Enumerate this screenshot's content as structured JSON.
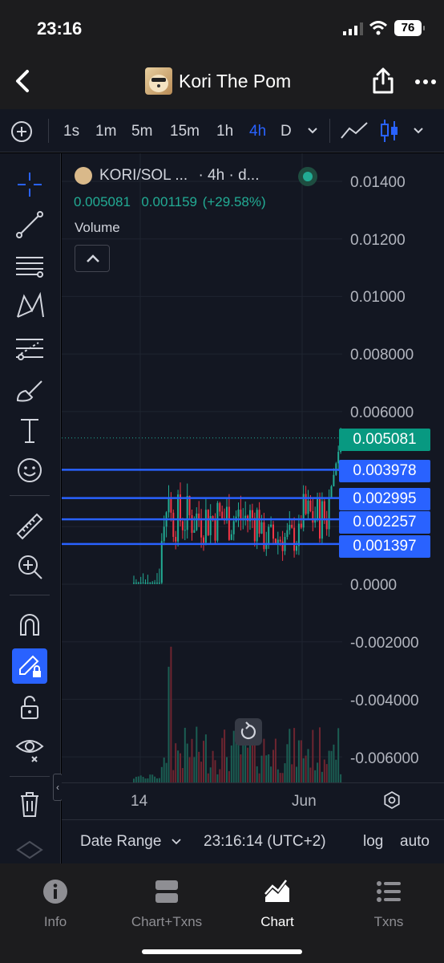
{
  "status_bar": {
    "time": "23:16",
    "battery": "76"
  },
  "header": {
    "title": "Kori The Pom"
  },
  "timeframes": [
    "1s",
    "1m",
    "5m",
    "15m",
    "1h",
    "4h",
    "D"
  ],
  "active_timeframe": "4h",
  "legend": {
    "symbol": "KORI/SOL ...",
    "interval": "· 4h · d...",
    "values": "0.005081  0.001159 (+29.58%)",
    "volume_label": "Volume"
  },
  "price_axis": [
    "0.01400",
    "0.01200",
    "0.01000",
    "0.008000",
    "0.006000",
    "0.0000",
    "-0.002000",
    "-0.004000",
    "-0.006000"
  ],
  "level_tags": {
    "current": "0.005081",
    "l1": "0.003978",
    "l2": "0.002995",
    "l3": "0.002257",
    "l4": "0.001397"
  },
  "x_axis": {
    "label_1": "14",
    "label_2": "Jun"
  },
  "chart_bottom": {
    "date_range": "Date Range",
    "clock": "23:16:14 (UTC+2)",
    "log": "log",
    "auto": "auto"
  },
  "nav": [
    {
      "label": "Info",
      "icon": "info-icon"
    },
    {
      "label": "Chart+Txns",
      "icon": "split-icon"
    },
    {
      "label": "Chart",
      "icon": "chart-icon"
    },
    {
      "label": "Txns",
      "icon": "list-icon"
    }
  ],
  "active_nav": "Chart",
  "colors": {
    "accent": "#2962ff",
    "up": "#22ab94",
    "down": "#f23645",
    "background": "#131722"
  }
}
